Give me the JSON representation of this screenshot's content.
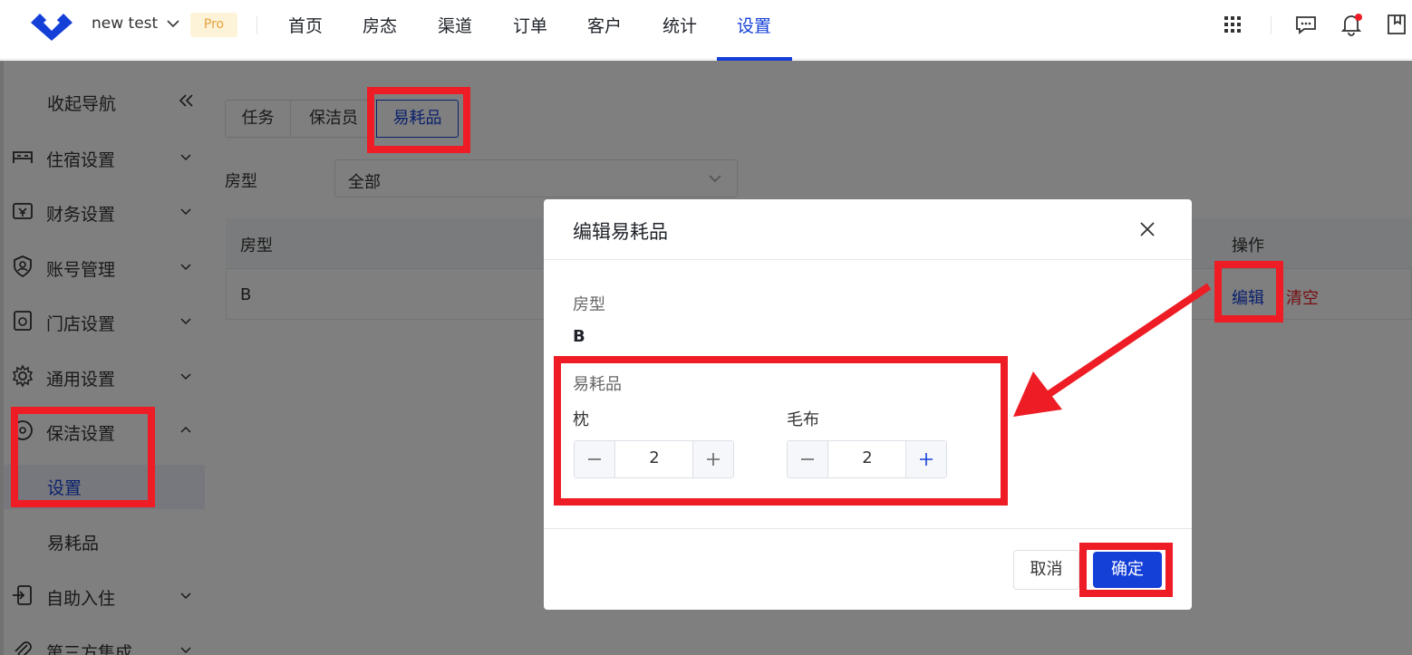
{
  "header": {
    "workspace": "new test",
    "pro_badge": "Pro",
    "nav": [
      "首页",
      "房态",
      "渠道",
      "订单",
      "客户",
      "统计",
      "设置"
    ],
    "active_nav": "设置",
    "colors": {
      "accent": "#1540d8",
      "notification_dot": "#ee1c24"
    },
    "icons": [
      "apps-icon",
      "message-icon",
      "bell-icon",
      "bookmark-icon"
    ]
  },
  "sidebar": {
    "collapse_label": "收起导航",
    "items": [
      {
        "label": "住宿设置",
        "icon": "bed-icon"
      },
      {
        "label": "财务设置",
        "icon": "cashier-icon"
      },
      {
        "label": "账号管理",
        "icon": "shield-user-icon"
      },
      {
        "label": "门店设置",
        "icon": "store-icon"
      },
      {
        "label": "通用设置",
        "icon": "gear-icon"
      },
      {
        "label": "保洁设置",
        "icon": "cleaning-icon"
      },
      {
        "label": "自助入住",
        "icon": "checkin-icon"
      },
      {
        "label": "第三方集成",
        "icon": "paperclip-icon"
      }
    ],
    "sub_items": [
      {
        "label": "设置",
        "active": true
      },
      {
        "label": "易耗品",
        "active": false
      }
    ]
  },
  "main": {
    "tabs": [
      "任务",
      "保洁员",
      "易耗品"
    ],
    "active_tab": "易耗品",
    "filter_label": "房型",
    "filter_value": "全部",
    "table": {
      "headers": [
        "房型",
        "操作"
      ],
      "rows": [
        {
          "room_type": "B",
          "actions": [
            "编辑",
            "清空"
          ]
        }
      ]
    }
  },
  "modal": {
    "title": "编辑易耗品",
    "room_type_label": "房型",
    "room_type_value": "B",
    "consumables_label": "易耗品",
    "items": [
      {
        "name": "枕",
        "quantity": "2"
      },
      {
        "name": "毛布",
        "quantity": "2"
      }
    ],
    "cancel_label": "取消",
    "confirm_label": "确定"
  }
}
